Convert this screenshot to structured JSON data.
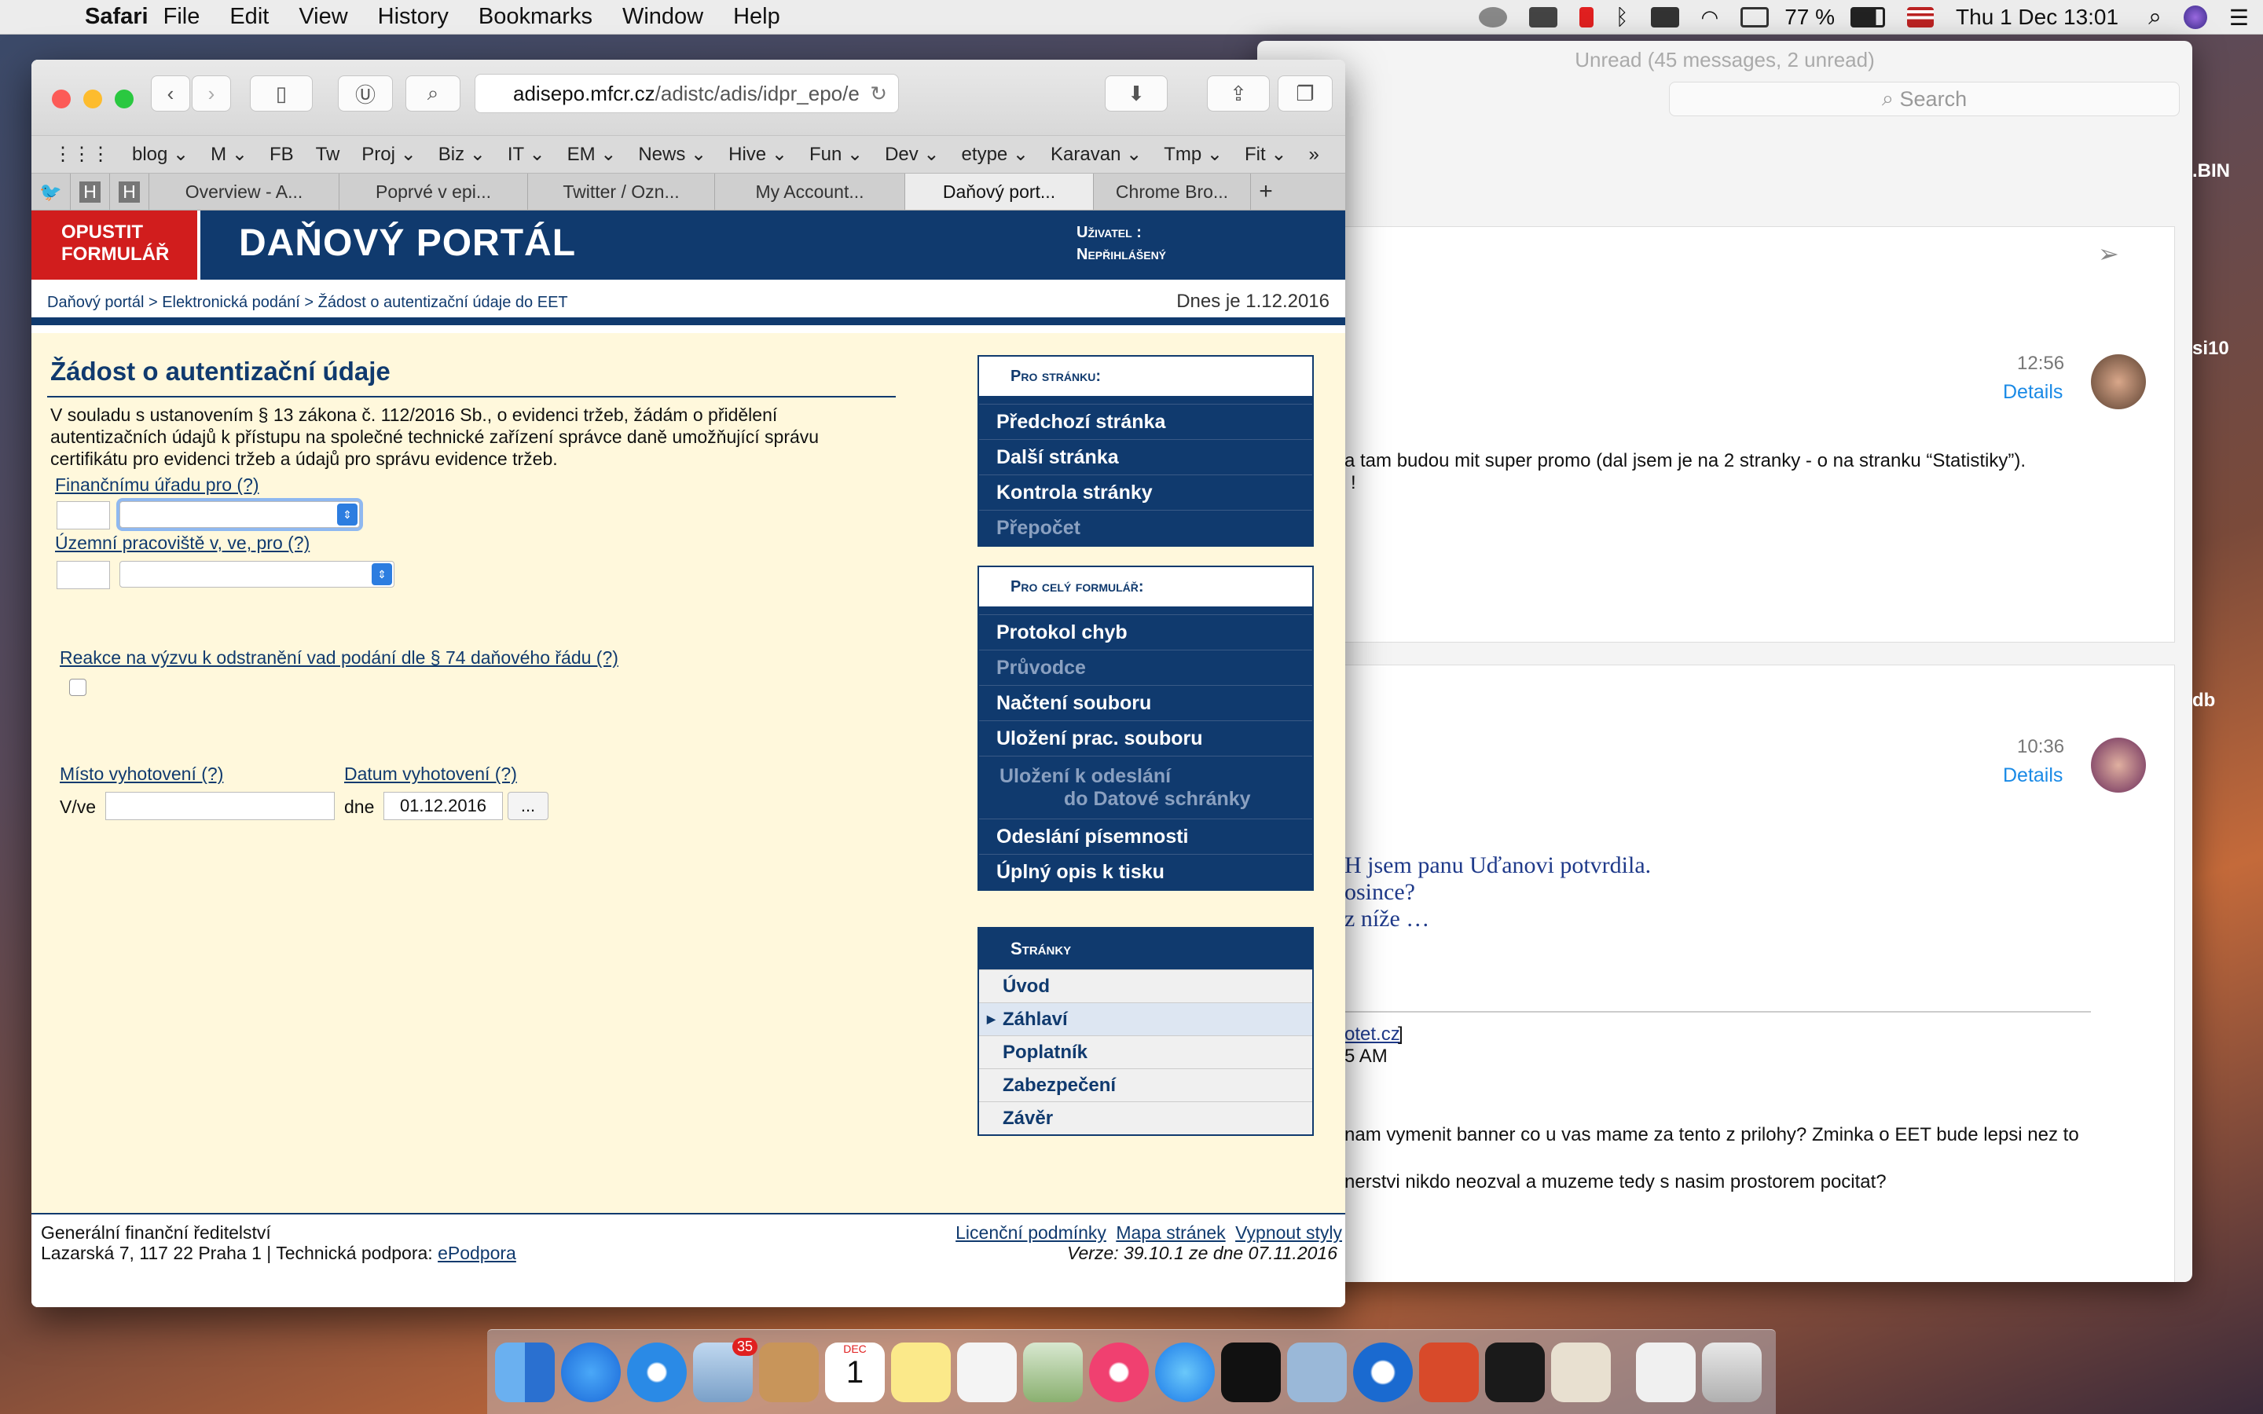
{
  "menubar": {
    "app": "Safari",
    "items": [
      "File",
      "Edit",
      "View",
      "History",
      "Bookmarks",
      "Window",
      "Help"
    ],
    "battery": "77 %",
    "datetime": "Thu 1 Dec  13:01"
  },
  "mail": {
    "title": "Unread (45 messages, 2 unread)",
    "search_placeholder": "Search",
    "side_labels": [
      ".BIN",
      "si10",
      "db"
    ],
    "message1": {
      "time": "12:56",
      "details": "Details",
      "line1": "a tam budou mit super promo (dal jsem je na 2 stranky - o na stranku “Statistiky”).",
      "line2": "!"
    },
    "message2": {
      "time": "10:36",
      "details": "Details",
      "q1": "H jsem panu Uďanovi potvrdila.",
      "q2": "osince?",
      "q3": "z níže …",
      "link": "otet.cz",
      "link_bracket": "]",
      "ampm": "5 AM",
      "p1": "nam vymenit banner co u vas mame za tento z prilohy? Zminka o EET bude lepsi nez to",
      "p2": "nerstvi nikdo neozval a muzeme tedy s nasim prostorem pocitat?"
    }
  },
  "safari": {
    "url_host": "adisepo.mfcr.cz",
    "url_rest": "/adistc/adis/idpr_epo/e",
    "favorites": [
      "blog",
      "M",
      "FB",
      "Tw",
      "Proj",
      "Biz",
      "IT",
      "EM",
      "News",
      "Hive",
      "Fun",
      "Dev",
      "etype",
      "Karavan",
      "Tmp",
      "Fit"
    ],
    "tabs": [
      "Overview - A...",
      "Poprvé v epi...",
      "Twitter / Ozn...",
      "My Account...",
      "Daňový port...",
      "Chrome Bro..."
    ],
    "active_tab": 4
  },
  "portal": {
    "exit": "OPUSTIT FORMULÁŘ",
    "title": "DAŇOVÝ PORTÁL",
    "user_label": "Uživatel :",
    "user_value": "Nepřihlášený",
    "breadcrumb": "Daňový portál > Elektronická podání > Žádost o autentizační údaje do EET",
    "date": "Dnes je 1.12.2016",
    "form_title": "Žádost o autentizační údaje",
    "intro": "V souladu s ustanovením § 13 zákona č. 112/2016 Sb., o evidenci tržeb, žádám o přidělení autentizačních údajů k přístupu na společné technické zařízení správce daně umožňující správu certifikátu pro evidenci tržeb a údajů pro správu evidence tržeb.",
    "fu_label": "Finančnímu úřadu pro (?)",
    "up_label": "Územní pracoviště v, ve, pro (?)",
    "reakce_label": "Reakce na výzvu k odstranění vad podání dle § 74 daňového řádu (?)",
    "misto_label": "Místo vyhotovení (?)",
    "datum_label": "Datum vyhotovení (?)",
    "vve": "V/ve",
    "dne": "dne",
    "date_value": "01.12.2016",
    "date_btn": "...",
    "menu_page_head": "Pro stránku:",
    "menu_page": [
      {
        "label": "Předchozí stránka",
        "enabled": true
      },
      {
        "label": "Další stránka",
        "enabled": true
      },
      {
        "label": "Kontrola stránky",
        "enabled": true
      },
      {
        "label": "Přepočet",
        "enabled": false
      }
    ],
    "menu_form_head": "Pro celý formulář:",
    "menu_form": [
      {
        "label": "Protokol chyb",
        "enabled": true
      },
      {
        "label": "Průvodce",
        "enabled": false
      },
      {
        "label": "Načtení souboru",
        "enabled": true
      },
      {
        "label": "Uložení prac. souboru",
        "enabled": true
      },
      {
        "label": "Uložení k odeslání",
        "label2": "do Datové schránky",
        "enabled": false
      },
      {
        "label": "Odeslání písemnosti",
        "enabled": true
      },
      {
        "label": "Úplný opis k tisku",
        "enabled": true
      }
    ],
    "pages_head": "Stránky",
    "pages": [
      "Úvod",
      "Záhlaví",
      "Poplatník",
      "Zabezpečení",
      "Závěr"
    ],
    "current_page": 1,
    "footer_org": "Generální finanční ředitelství",
    "footer_addr": "Lazarská 7, 117 22 Praha 1 | Technická podpora: ",
    "footer_support": "ePodpora",
    "footer_links": [
      "Licenční podmínky",
      "Mapa stránek",
      "Vypnout styly"
    ],
    "version": "Verze: 39.10.1 ze dne 07.11.2016"
  },
  "dock": {
    "mail_badge": "35",
    "cal_month": "DEC",
    "cal_day": "1"
  }
}
